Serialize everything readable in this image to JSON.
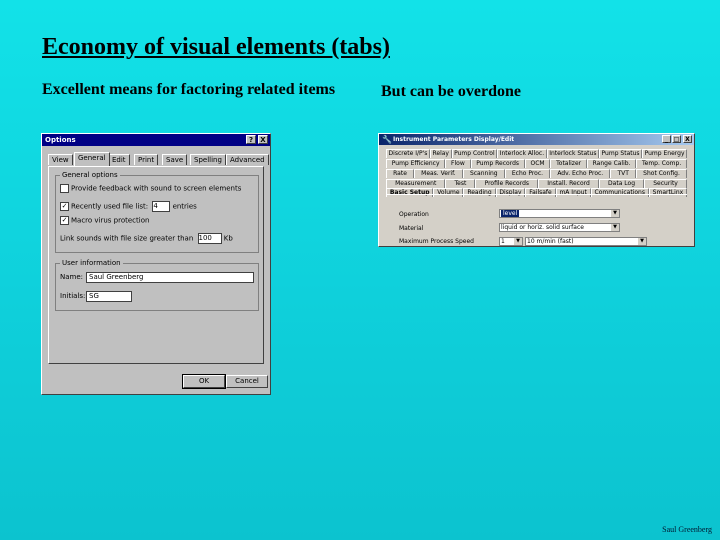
{
  "slide": {
    "title": "Economy of visual elements (tabs)",
    "left_text": "Excellent means for factoring related items",
    "right_text": "But can be overdone",
    "footer": "Saul Greenberg"
  },
  "options_dialog": {
    "title": "Options",
    "help_btn": "?",
    "close_btn": "X",
    "tabs": [
      "View",
      "General",
      "Edit",
      "Print",
      "Save",
      "Spelling",
      "Advanced"
    ],
    "selected_tab": "General",
    "general_group": "General options",
    "provide_feedback": "Provide feedback with sound to screen elements",
    "recently_used": "Recently used file list:",
    "recent_count": "4",
    "entries": "entries",
    "macro_virus": "Macro virus protection",
    "link_sounds": "Link sounds with file size greater than",
    "link_size": "100",
    "kb": "Kb",
    "user_group": "User information",
    "name_label": "Name:",
    "name_value": "Saul Greenberg",
    "initials_label": "Initials:",
    "initials_value": "SG",
    "ok": "OK",
    "cancel": "Cancel"
  },
  "instrument_dialog": {
    "title": "Instrument Parameters Display/Edit",
    "min": "_",
    "max": "□",
    "close": "X",
    "tab_rows": [
      [
        "Discrete I/P's",
        "Relay",
        "Pump Control",
        "Interlock Alloc.",
        "Interlock Status",
        "Pump Status",
        "Pump Energy"
      ],
      [
        "Pump Efficiency",
        "Flow",
        "Pump Records",
        "OCM",
        "Totalizer",
        "Range Calib.",
        "Temp. Comp."
      ],
      [
        "Rate",
        "Meas. Verif.",
        "Scanning",
        "Echo Proc.",
        "Adv. Echo Proc.",
        "TVT",
        "Shot Config."
      ],
      [
        "Measurement",
        "Test",
        "Profile Records",
        "Install. Record",
        "Data Log",
        "Security"
      ],
      [
        "Basic Setup",
        "Volume",
        "Reading",
        "Display",
        "Failsafe",
        "mA Input",
        "Communications",
        "SmartLinx"
      ]
    ],
    "operation_label": "Operation",
    "operation_value": "level",
    "material_label": "Material",
    "material_value": "liquid or horiz. solid surface",
    "max_speed_label": "Maximum Process Speed",
    "max_speed_num": "1",
    "max_speed_value": "10 m/min (fast)"
  }
}
